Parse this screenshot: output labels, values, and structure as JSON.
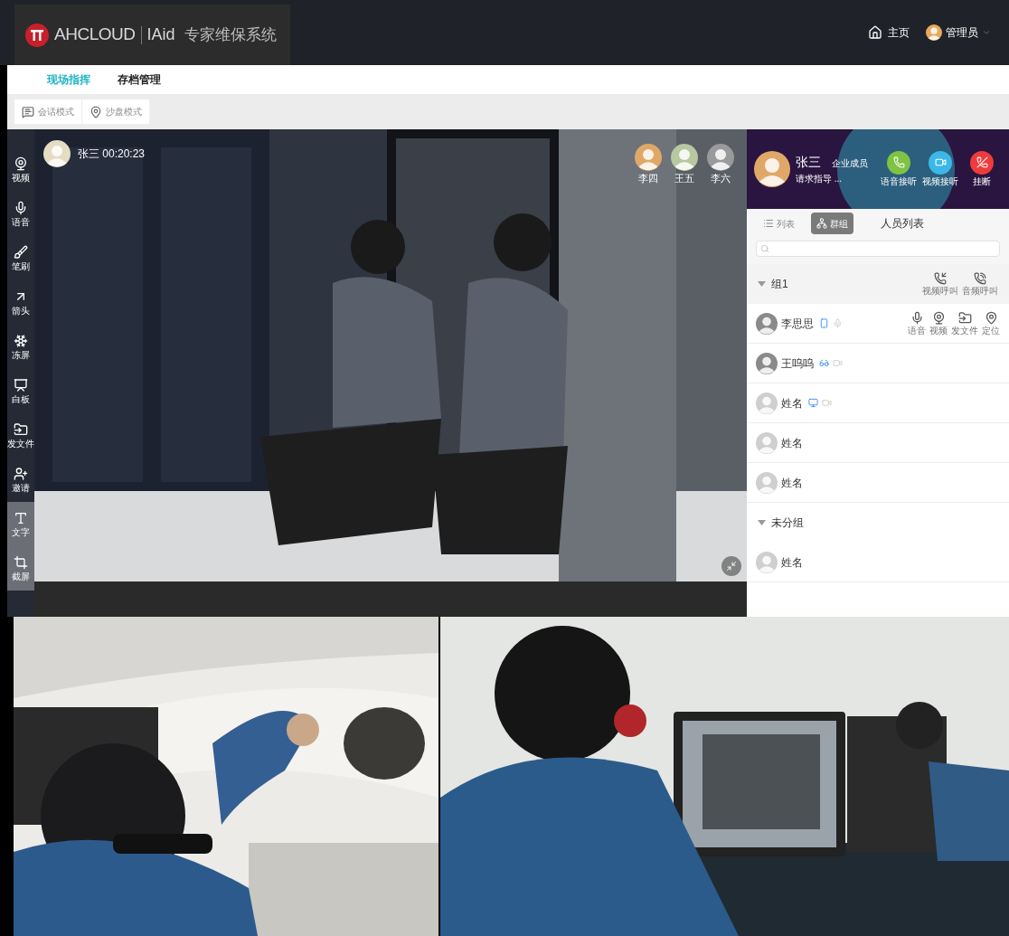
{
  "header": {
    "brand": "AHCLOUD",
    "product": "IAid",
    "system": "专家维保系统",
    "home": "主页",
    "user": "管理员"
  },
  "nav_tabs": [
    {
      "label": "现场指挥",
      "selected": true
    },
    {
      "label": "存档管理",
      "selected": false
    }
  ],
  "modes": [
    {
      "kind": "chat",
      "label": "会话模式"
    },
    {
      "kind": "map",
      "label": "沙盘模式"
    }
  ],
  "tools": [
    {
      "kind": "video",
      "label": "视频",
      "selected": false
    },
    {
      "kind": "voice",
      "label": "语音",
      "selected": false
    },
    {
      "kind": "brush",
      "label": "笔刷",
      "selected": false
    },
    {
      "kind": "arrow",
      "label": "箭头",
      "selected": false
    },
    {
      "kind": "freeze",
      "label": "冻屏",
      "selected": false
    },
    {
      "kind": "board",
      "label": "白板",
      "selected": false
    },
    {
      "kind": "file",
      "label": "发文件",
      "selected": false
    },
    {
      "kind": "invite",
      "label": "邀请",
      "selected": false
    },
    {
      "kind": "text",
      "label": "文字",
      "selected": true
    },
    {
      "kind": "crop",
      "label": "截屏",
      "selected": true
    }
  ],
  "video": {
    "caller": "张三 00:20:23",
    "participants": [
      "李四",
      "王五",
      "李六"
    ]
  },
  "incoming_call": {
    "name": "张三",
    "role": "企业成员",
    "message": "请求指导 ...",
    "actions": [
      {
        "kind": "voice",
        "label": "语音接听"
      },
      {
        "kind": "video",
        "label": "视频接听"
      },
      {
        "kind": "hangup",
        "label": "挂断"
      }
    ]
  },
  "panel": {
    "tabs": [
      {
        "kind": "list",
        "label": "列表",
        "selected": false
      },
      {
        "kind": "group",
        "label": "群组",
        "selected": true
      }
    ],
    "title": "人员列表"
  },
  "groups": [
    {
      "name": "组1",
      "expanded": true,
      "actions": [
        {
          "kind": "video",
          "label": "视频呼叫"
        },
        {
          "kind": "audio",
          "label": "音频呼叫"
        }
      ],
      "members": [
        {
          "name": "李思思",
          "online": true,
          "devices": [
            {
              "kind": "phone",
              "active": true
            },
            {
              "kind": "mic",
              "active": false
            }
          ],
          "actions": [
            {
              "kind": "voice",
              "label": "语音"
            },
            {
              "kind": "video",
              "label": "视频"
            },
            {
              "kind": "file",
              "label": "发文件"
            },
            {
              "kind": "locate",
              "label": "定位"
            }
          ]
        },
        {
          "name": "王呜呜",
          "online": true,
          "devices": [
            {
              "kind": "glasses",
              "active": true
            },
            {
              "kind": "camera",
              "active": false
            }
          ]
        },
        {
          "name": "姓名",
          "online": false,
          "devices": [
            {
              "kind": "monitor",
              "active": true
            },
            {
              "kind": "camera",
              "active": false
            }
          ]
        },
        {
          "name": "姓名",
          "online": false
        },
        {
          "name": "姓名",
          "online": false
        }
      ]
    },
    {
      "name": "未分组",
      "expanded": true,
      "members": [
        {
          "name": "姓名",
          "online": false
        }
      ]
    }
  ]
}
